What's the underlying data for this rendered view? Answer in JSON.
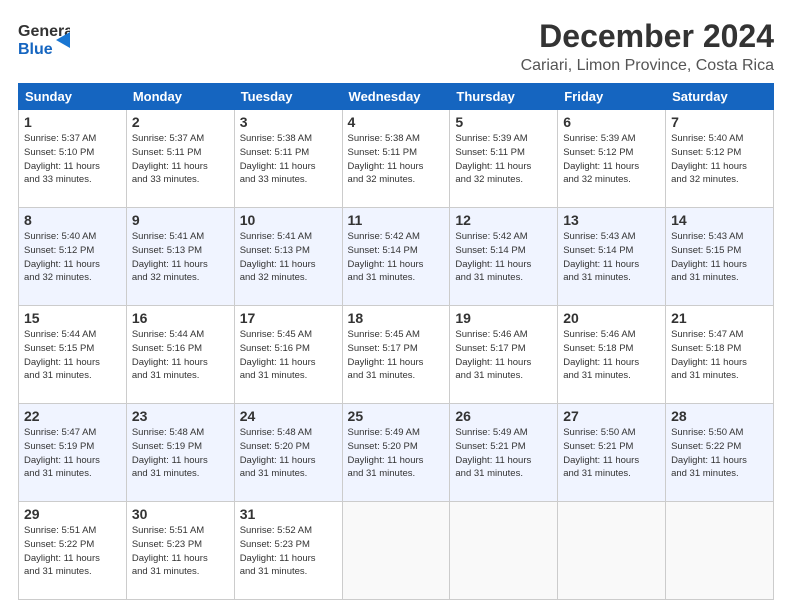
{
  "logo": {
    "general": "General",
    "blue": "Blue"
  },
  "header": {
    "month_year": "December 2024",
    "location": "Cariari, Limon Province, Costa Rica"
  },
  "days_of_week": [
    "Sunday",
    "Monday",
    "Tuesday",
    "Wednesday",
    "Thursday",
    "Friday",
    "Saturday"
  ],
  "weeks": [
    [
      {
        "day": "1",
        "info": "Sunrise: 5:37 AM\nSunset: 5:10 PM\nDaylight: 11 hours\nand 33 minutes."
      },
      {
        "day": "2",
        "info": "Sunrise: 5:37 AM\nSunset: 5:11 PM\nDaylight: 11 hours\nand 33 minutes."
      },
      {
        "day": "3",
        "info": "Sunrise: 5:38 AM\nSunset: 5:11 PM\nDaylight: 11 hours\nand 33 minutes."
      },
      {
        "day": "4",
        "info": "Sunrise: 5:38 AM\nSunset: 5:11 PM\nDaylight: 11 hours\nand 32 minutes."
      },
      {
        "day": "5",
        "info": "Sunrise: 5:39 AM\nSunset: 5:11 PM\nDaylight: 11 hours\nand 32 minutes."
      },
      {
        "day": "6",
        "info": "Sunrise: 5:39 AM\nSunset: 5:12 PM\nDaylight: 11 hours\nand 32 minutes."
      },
      {
        "day": "7",
        "info": "Sunrise: 5:40 AM\nSunset: 5:12 PM\nDaylight: 11 hours\nand 32 minutes."
      }
    ],
    [
      {
        "day": "8",
        "info": "Sunrise: 5:40 AM\nSunset: 5:12 PM\nDaylight: 11 hours\nand 32 minutes."
      },
      {
        "day": "9",
        "info": "Sunrise: 5:41 AM\nSunset: 5:13 PM\nDaylight: 11 hours\nand 32 minutes."
      },
      {
        "day": "10",
        "info": "Sunrise: 5:41 AM\nSunset: 5:13 PM\nDaylight: 11 hours\nand 32 minutes."
      },
      {
        "day": "11",
        "info": "Sunrise: 5:42 AM\nSunset: 5:14 PM\nDaylight: 11 hours\nand 31 minutes."
      },
      {
        "day": "12",
        "info": "Sunrise: 5:42 AM\nSunset: 5:14 PM\nDaylight: 11 hours\nand 31 minutes."
      },
      {
        "day": "13",
        "info": "Sunrise: 5:43 AM\nSunset: 5:14 PM\nDaylight: 11 hours\nand 31 minutes."
      },
      {
        "day": "14",
        "info": "Sunrise: 5:43 AM\nSunset: 5:15 PM\nDaylight: 11 hours\nand 31 minutes."
      }
    ],
    [
      {
        "day": "15",
        "info": "Sunrise: 5:44 AM\nSunset: 5:15 PM\nDaylight: 11 hours\nand 31 minutes."
      },
      {
        "day": "16",
        "info": "Sunrise: 5:44 AM\nSunset: 5:16 PM\nDaylight: 11 hours\nand 31 minutes."
      },
      {
        "day": "17",
        "info": "Sunrise: 5:45 AM\nSunset: 5:16 PM\nDaylight: 11 hours\nand 31 minutes."
      },
      {
        "day": "18",
        "info": "Sunrise: 5:45 AM\nSunset: 5:17 PM\nDaylight: 11 hours\nand 31 minutes."
      },
      {
        "day": "19",
        "info": "Sunrise: 5:46 AM\nSunset: 5:17 PM\nDaylight: 11 hours\nand 31 minutes."
      },
      {
        "day": "20",
        "info": "Sunrise: 5:46 AM\nSunset: 5:18 PM\nDaylight: 11 hours\nand 31 minutes."
      },
      {
        "day": "21",
        "info": "Sunrise: 5:47 AM\nSunset: 5:18 PM\nDaylight: 11 hours\nand 31 minutes."
      }
    ],
    [
      {
        "day": "22",
        "info": "Sunrise: 5:47 AM\nSunset: 5:19 PM\nDaylight: 11 hours\nand 31 minutes."
      },
      {
        "day": "23",
        "info": "Sunrise: 5:48 AM\nSunset: 5:19 PM\nDaylight: 11 hours\nand 31 minutes."
      },
      {
        "day": "24",
        "info": "Sunrise: 5:48 AM\nSunset: 5:20 PM\nDaylight: 11 hours\nand 31 minutes."
      },
      {
        "day": "25",
        "info": "Sunrise: 5:49 AM\nSunset: 5:20 PM\nDaylight: 11 hours\nand 31 minutes."
      },
      {
        "day": "26",
        "info": "Sunrise: 5:49 AM\nSunset: 5:21 PM\nDaylight: 11 hours\nand 31 minutes."
      },
      {
        "day": "27",
        "info": "Sunrise: 5:50 AM\nSunset: 5:21 PM\nDaylight: 11 hours\nand 31 minutes."
      },
      {
        "day": "28",
        "info": "Sunrise: 5:50 AM\nSunset: 5:22 PM\nDaylight: 11 hours\nand 31 minutes."
      }
    ],
    [
      {
        "day": "29",
        "info": "Sunrise: 5:51 AM\nSunset: 5:22 PM\nDaylight: 11 hours\nand 31 minutes."
      },
      {
        "day": "30",
        "info": "Sunrise: 5:51 AM\nSunset: 5:23 PM\nDaylight: 11 hours\nand 31 minutes."
      },
      {
        "day": "31",
        "info": "Sunrise: 5:52 AM\nSunset: 5:23 PM\nDaylight: 11 hours\nand 31 minutes."
      },
      {
        "day": "",
        "info": ""
      },
      {
        "day": "",
        "info": ""
      },
      {
        "day": "",
        "info": ""
      },
      {
        "day": "",
        "info": ""
      }
    ]
  ]
}
